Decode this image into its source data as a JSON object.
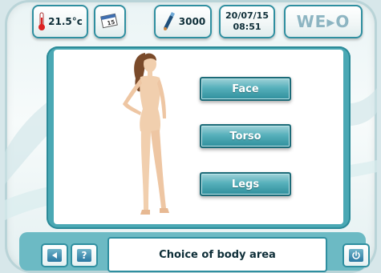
{
  "topbar": {
    "temperature": "21.5°c",
    "count": "3000",
    "date": "20/07/15",
    "time": "08:51",
    "logo": "WE▸O",
    "calendar_day": "15"
  },
  "body_areas": {
    "face": "Face",
    "torso": "Torso",
    "legs": "Legs"
  },
  "footer": {
    "status": "Choice of body area",
    "help": "?"
  },
  "icons": {
    "temperature": "thermometer-icon",
    "calendar": "calendar-icon",
    "counter": "handpiece-icon",
    "back": "back-arrow-icon",
    "power": "power-icon"
  },
  "colors": {
    "accent": "#2f8fa0",
    "button": "#57b0bb",
    "skin": "#f1cfae"
  }
}
